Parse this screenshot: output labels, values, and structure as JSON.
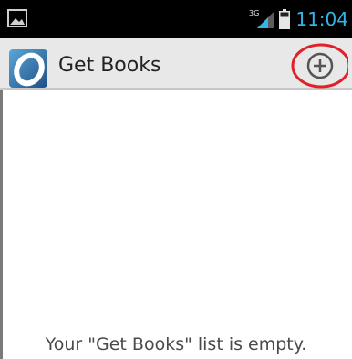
{
  "status_bar": {
    "time": "11:04",
    "network_type": "3G",
    "time_color": "#33b5e5"
  },
  "action_bar": {
    "title": "Get Books",
    "add_icon": "add-circle-icon",
    "highlight_color": "#e0202a"
  },
  "main": {
    "empty_message": "Your \"Get Books\" list is empty."
  }
}
